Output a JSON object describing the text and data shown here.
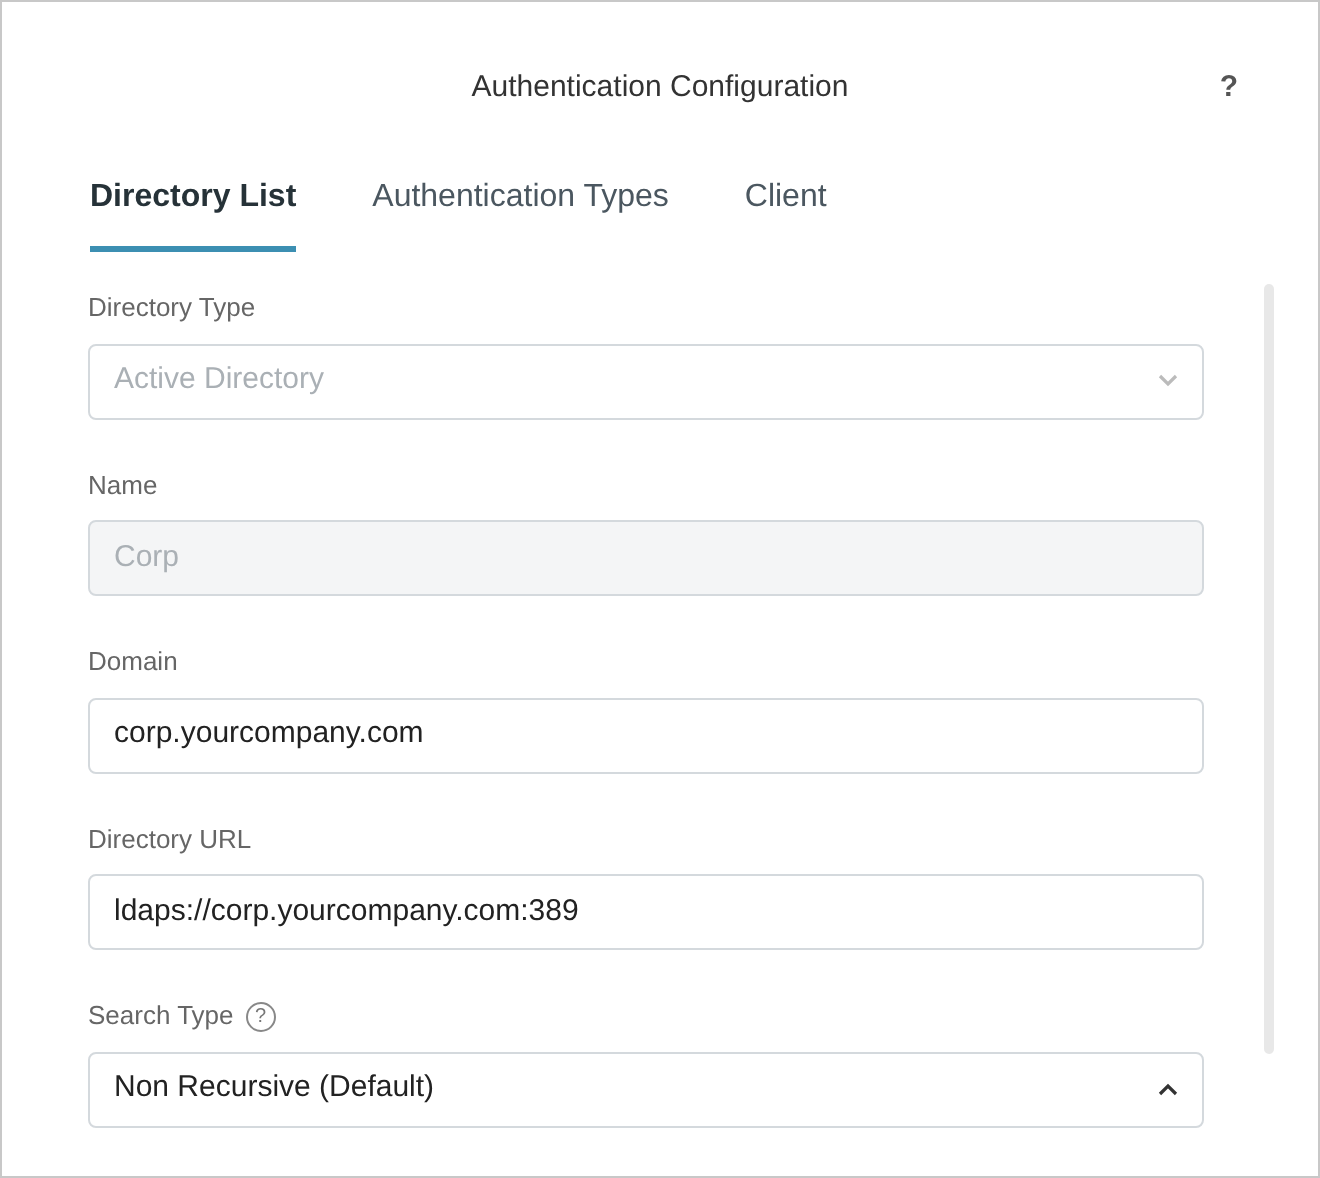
{
  "dialog": {
    "title": "Authentication Configuration",
    "help": "?"
  },
  "tabs": [
    {
      "label": "Directory List",
      "selected": true
    },
    {
      "label": "Authentication Types",
      "selected": false
    },
    {
      "label": "Client",
      "selected": false
    }
  ],
  "fields": [
    {
      "label": "Directory Type",
      "kind": "select",
      "value": "Active Directory",
      "disabled": true,
      "expanded": false
    },
    {
      "label": "Name",
      "kind": "input",
      "value": "Corp",
      "disabled": true
    },
    {
      "label": "Domain",
      "kind": "input",
      "value": "corp.yourcompany.com",
      "disabled": false
    },
    {
      "label": "Directory URL",
      "kind": "input",
      "value": "ldaps://corp.yourcompany.com:389",
      "disabled": false
    },
    {
      "label": "Search Type",
      "kind": "select",
      "value": "Non Recursive (Default)",
      "disabled": false,
      "help": "?",
      "expanded": true
    }
  ]
}
